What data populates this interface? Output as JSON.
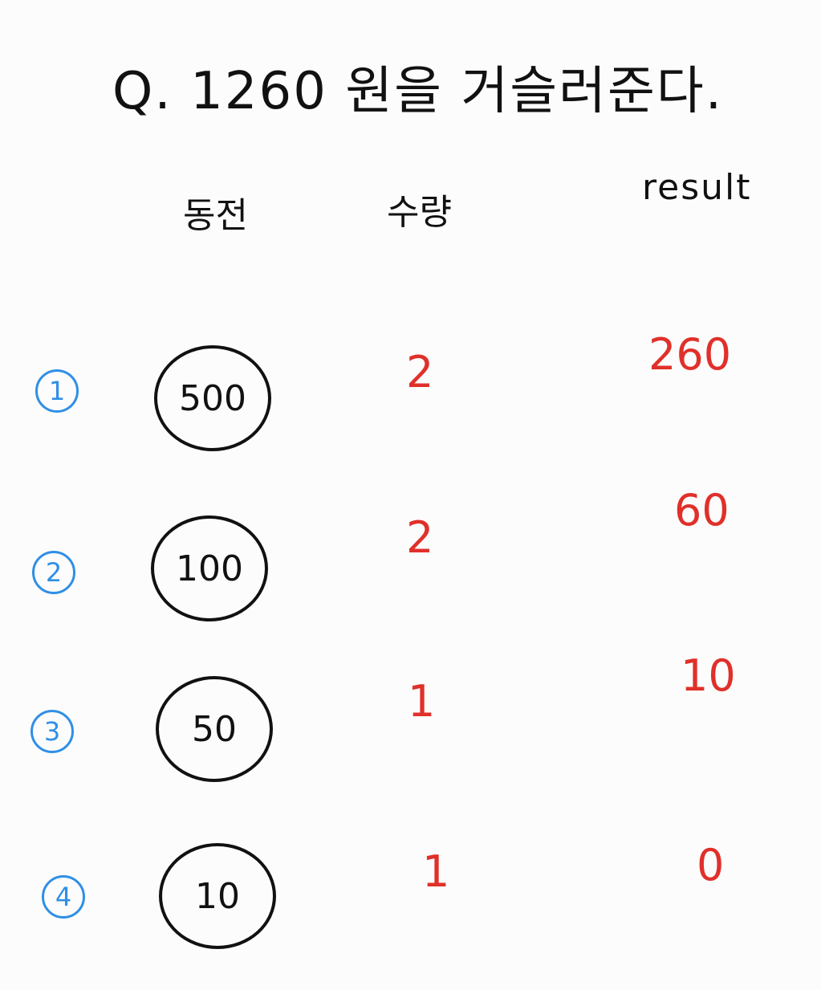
{
  "title": "Q. 1260 원을 거슬러준다.",
  "headers": {
    "coin": "동전",
    "quantity": "수량",
    "result": "result"
  },
  "rows": [
    {
      "step": "1",
      "coin": "500",
      "quantity": "2",
      "result": "260"
    },
    {
      "step": "2",
      "coin": "100",
      "quantity": "2",
      "result": "60"
    },
    {
      "step": "3",
      "coin": "50",
      "quantity": "1",
      "result": "10"
    },
    {
      "step": "4",
      "coin": "10",
      "quantity": "1",
      "result": "0"
    }
  ],
  "colors": {
    "ink": "#111111",
    "step_blue": "#2f8fe6",
    "answer_red": "#e0302a"
  }
}
